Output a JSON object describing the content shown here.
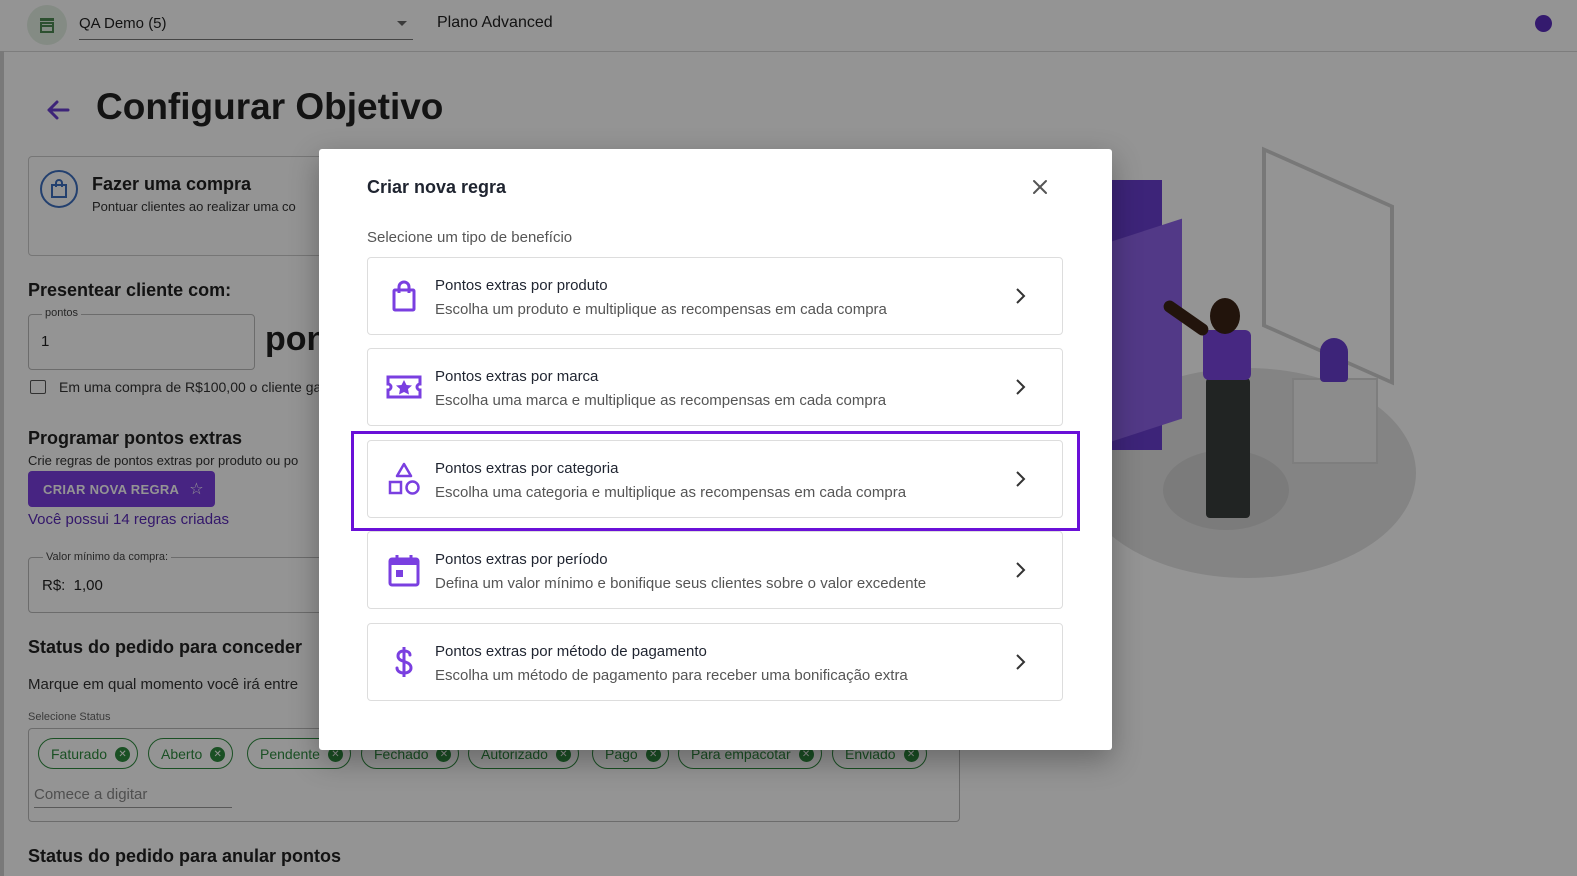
{
  "topbar": {
    "store_name": "QA Demo (5)",
    "plan": "Plano Advanced",
    "icons": [
      "store-icon",
      "user-icon"
    ]
  },
  "page": {
    "title": "Configurar Objetivo",
    "goal": {
      "title": "Fazer uma compra",
      "subtitle": "Pontuar clientes ao realizar uma co"
    },
    "reward": {
      "heading": "Presentear cliente com:",
      "points_label": "pontos",
      "points_value": "1",
      "suffix": "pon",
      "hint": "Em uma compra de R$100,00 o cliente ga"
    },
    "extra": {
      "heading": "Programar pontos extras",
      "description": "Crie regras de pontos extras por produto ou po",
      "button_label": "CRIAR NOVA REGRA",
      "rules_link": "Você possui 14 regras criadas"
    },
    "min_value": {
      "label": "Valor mínimo da compra:",
      "value": "R$:  1,00"
    },
    "status_grant": {
      "heading": "Status do pedido para conceder",
      "description": "Marque em qual momento você irá entre",
      "select_label": "Selecione Status",
      "chips": [
        "Faturado",
        "Aberto",
        "Pendente",
        "Fechado",
        "Autorizado",
        "Pago",
        "Para empacotar",
        "Enviado"
      ],
      "placeholder": "Comece a digitar"
    },
    "status_cancel": {
      "heading": "Status do pedido para anular pontos"
    }
  },
  "modal": {
    "title": "Criar nova regra",
    "subtitle": "Selecione um tipo de benefício",
    "options": [
      {
        "title": "Pontos extras por produto",
        "description": "Escolha um produto e multiplique as recompensas em cada compra",
        "icon": "shopping-bag-icon"
      },
      {
        "title": "Pontos extras por marca",
        "description": "Escolha uma marca e multiplique as recompensas em cada compra",
        "icon": "ticket-star-icon"
      },
      {
        "title": "Pontos extras por categoria",
        "description": "Escolha uma categoria e multiplique as recompensas em cada compra",
        "icon": "shapes-icon"
      },
      {
        "title": "Pontos extras por período",
        "description": "Defina um valor mínimo e bonifique seus clientes sobre o valor excedente",
        "icon": "calendar-icon"
      },
      {
        "title": "Pontos extras por método de pagamento",
        "description": "Escolha um método de pagamento para receber uma bonificação extra",
        "icon": "dollar-icon"
      }
    ]
  },
  "colors": {
    "accent": "#7a3fe0",
    "highlight": "#6a10d8",
    "chip_green": "#2e8b3e"
  }
}
